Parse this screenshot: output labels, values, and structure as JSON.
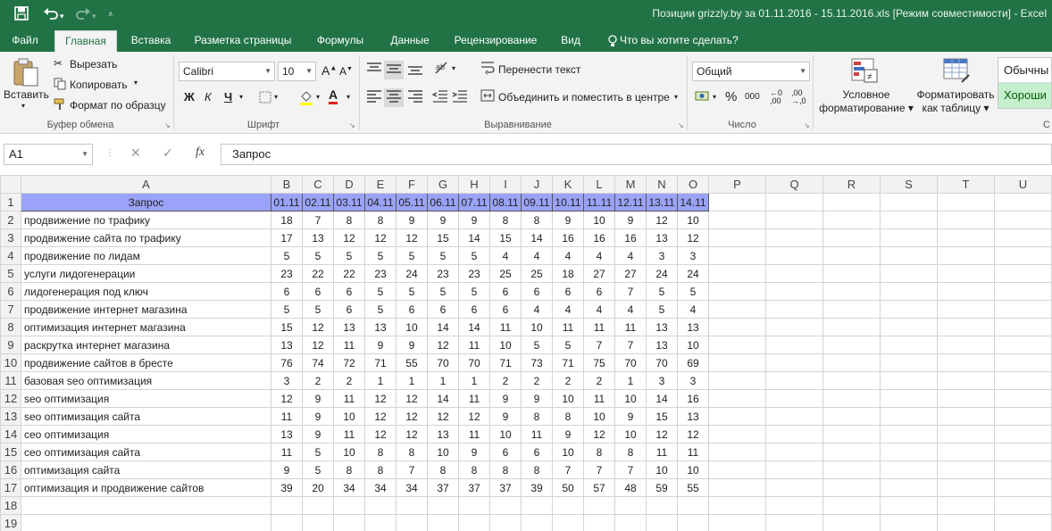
{
  "window": {
    "title": "Позиции grizzly.by за 01.11.2016 - 15.11.2016.xls  [Режим совместимости] - Excel"
  },
  "quick_access": {
    "icons": [
      "save-icon",
      "undo-icon",
      "redo-icon",
      "customize-icon"
    ]
  },
  "tabs": [
    "Файл",
    "Главная",
    "Вставка",
    "Разметка страницы",
    "Формулы",
    "Данные",
    "Рецензирование",
    "Вид",
    "Что вы хотите сделать?"
  ],
  "active_tab": "Главная",
  "ribbon": {
    "clipboard": {
      "paste": "Вставить",
      "cut": "Вырезать",
      "copy": "Копировать",
      "format_painter": "Формат по образцу",
      "group": "Буфер обмена"
    },
    "font": {
      "name": "Calibri",
      "size": "10",
      "bold": "Ж",
      "italic": "К",
      "underline": "Ч",
      "group": "Шрифт"
    },
    "alignment": {
      "wrap": "Перенести текст",
      "merge": "Объединить и поместить в центре",
      "group": "Выравнивание"
    },
    "number": {
      "format": "Общий",
      "percent": "%",
      "thousands": "000",
      "group": "Число"
    },
    "styles": {
      "conditional": [
        "Условное",
        "форматирование"
      ],
      "table": [
        "Форматировать",
        "как таблицу"
      ],
      "normal": "Обычны",
      "good": "Хороши",
      "group_partial": "С"
    }
  },
  "formula_bar": {
    "name_box": "A1",
    "fx": "fx",
    "value": "Запрос"
  },
  "columns": [
    "A",
    "B",
    "C",
    "D",
    "E",
    "F",
    "G",
    "H",
    "I",
    "J",
    "K",
    "L",
    "M",
    "N",
    "O",
    "P",
    "Q",
    "R",
    "S",
    "T",
    "U"
  ],
  "header_row": [
    "Запрос",
    "01.11",
    "02.11",
    "03.11",
    "04.11",
    "05.11",
    "06.11",
    "07.11",
    "08.11",
    "09.11",
    "10.11",
    "11.11",
    "12.11",
    "13.11",
    "14.11"
  ],
  "rows": [
    {
      "query": "продвижение по трафику",
      "values": [
        "18",
        "7",
        "8",
        "8",
        "9",
        "9",
        "9",
        "8",
        "8",
        "9",
        "10",
        "9",
        "12",
        "10"
      ]
    },
    {
      "query": "продвижение сайта по трафику",
      "values": [
        "17",
        "13",
        "12",
        "12",
        "12",
        "15",
        "14",
        "15",
        "14",
        "16",
        "16",
        "16",
        "13",
        "12"
      ]
    },
    {
      "query": "продвижение по лидам",
      "values": [
        "5",
        "5",
        "5",
        "5",
        "5",
        "5",
        "5",
        "4",
        "4",
        "4",
        "4",
        "4",
        "3",
        "3"
      ]
    },
    {
      "query": "услуги лидогенерации",
      "values": [
        "23",
        "22",
        "22",
        "23",
        "24",
        "23",
        "23",
        "25",
        "25",
        "18",
        "27",
        "27",
        "24",
        "24"
      ]
    },
    {
      "query": "лидогенерация под ключ",
      "values": [
        "6",
        "6",
        "6",
        "5",
        "5",
        "5",
        "5",
        "6",
        "6",
        "6",
        "6",
        "7",
        "5",
        "5"
      ]
    },
    {
      "query": "продвижение интернет магазина",
      "values": [
        "5",
        "5",
        "6",
        "5",
        "6",
        "6",
        "6",
        "6",
        "4",
        "4",
        "4",
        "4",
        "5",
        "4"
      ]
    },
    {
      "query": "оптимизация интернет магазина",
      "values": [
        "15",
        "12",
        "13",
        "13",
        "10",
        "14",
        "14",
        "11",
        "10",
        "11",
        "11",
        "11",
        "13",
        "13"
      ]
    },
    {
      "query": "раскрутка интернет магазина",
      "values": [
        "13",
        "12",
        "11",
        "9",
        "9",
        "12",
        "11",
        "10",
        "5",
        "5",
        "7",
        "7",
        "13",
        "10"
      ]
    },
    {
      "query": "продвижение сайтов в бресте",
      "values": [
        "76",
        "74",
        "72",
        "71",
        "55",
        "70",
        "70",
        "71",
        "73",
        "71",
        "75",
        "70",
        "70",
        "69"
      ]
    },
    {
      "query": "базовая seo оптимизация",
      "values": [
        "3",
        "2",
        "2",
        "1",
        "1",
        "1",
        "1",
        "2",
        "2",
        "2",
        "2",
        "1",
        "3",
        "3"
      ]
    },
    {
      "query": "seo оптимизация",
      "values": [
        "12",
        "9",
        "11",
        "12",
        "12",
        "14",
        "11",
        "9",
        "9",
        "10",
        "11",
        "10",
        "14",
        "16"
      ]
    },
    {
      "query": "seo оптимизация сайта",
      "values": [
        "11",
        "9",
        "10",
        "12",
        "12",
        "12",
        "12",
        "9",
        "8",
        "8",
        "10",
        "9",
        "15",
        "13"
      ]
    },
    {
      "query": "сео оптимизация",
      "values": [
        "13",
        "9",
        "11",
        "12",
        "12",
        "13",
        "11",
        "10",
        "11",
        "9",
        "12",
        "10",
        "12",
        "12"
      ]
    },
    {
      "query": "сео оптимизация сайта",
      "values": [
        "11",
        "5",
        "10",
        "8",
        "8",
        "10",
        "9",
        "6",
        "6",
        "10",
        "8",
        "8",
        "11",
        "11"
      ]
    },
    {
      "query": "оптимизация сайта",
      "values": [
        "9",
        "5",
        "8",
        "8",
        "7",
        "8",
        "8",
        "8",
        "8",
        "7",
        "7",
        "7",
        "10",
        "10"
      ]
    },
    {
      "query": "оптимизация и продвижение сайтов",
      "values": [
        "39",
        "20",
        "34",
        "34",
        "34",
        "37",
        "37",
        "37",
        "39",
        "50",
        "57",
        "48",
        "59",
        "55"
      ]
    },
    {
      "query": "",
      "values": [
        "",
        "",
        "",
        "",
        "",
        "",
        "",
        "",
        "",
        "",
        "",
        "",
        "",
        ""
      ]
    },
    {
      "query": "",
      "values": [
        "",
        "",
        "",
        "",
        "",
        "",
        "",
        "",
        "",
        "",
        "",
        "",
        "",
        ""
      ]
    },
    {
      "query": "",
      "values": [
        "",
        "",
        "",
        "",
        "",
        "",
        "",
        "",
        "",
        "",
        "",
        "",
        "",
        ""
      ]
    }
  ],
  "colors": {
    "excel_green": "#217346",
    "header_fill": "#9aa3f7",
    "good_fill": "#c6efce",
    "good_text": "#006100"
  }
}
